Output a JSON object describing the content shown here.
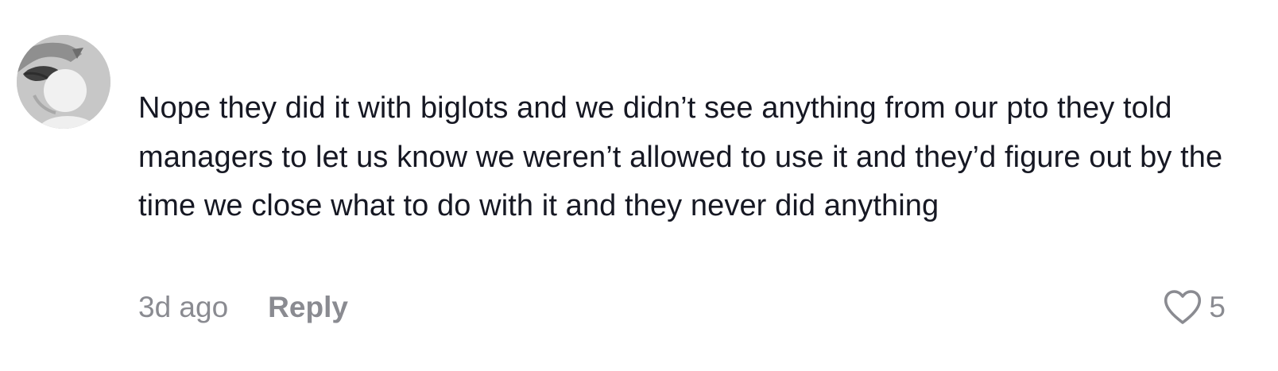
{
  "comment": {
    "text": "Nope they did it with biglots and we didn’t see anything from our pto they told managers to let us know we weren’t allowed to use it and they’d figure out by the time we close what to do with it and they never did anything",
    "timestamp": "3d ago",
    "reply_label": "Reply",
    "like_count": "5"
  },
  "icons": {
    "avatar": "user-avatar",
    "like": "heart-outline-icon"
  },
  "colors": {
    "text": "#161823",
    "secondary": "#8a8b91",
    "background": "#ffffff"
  }
}
